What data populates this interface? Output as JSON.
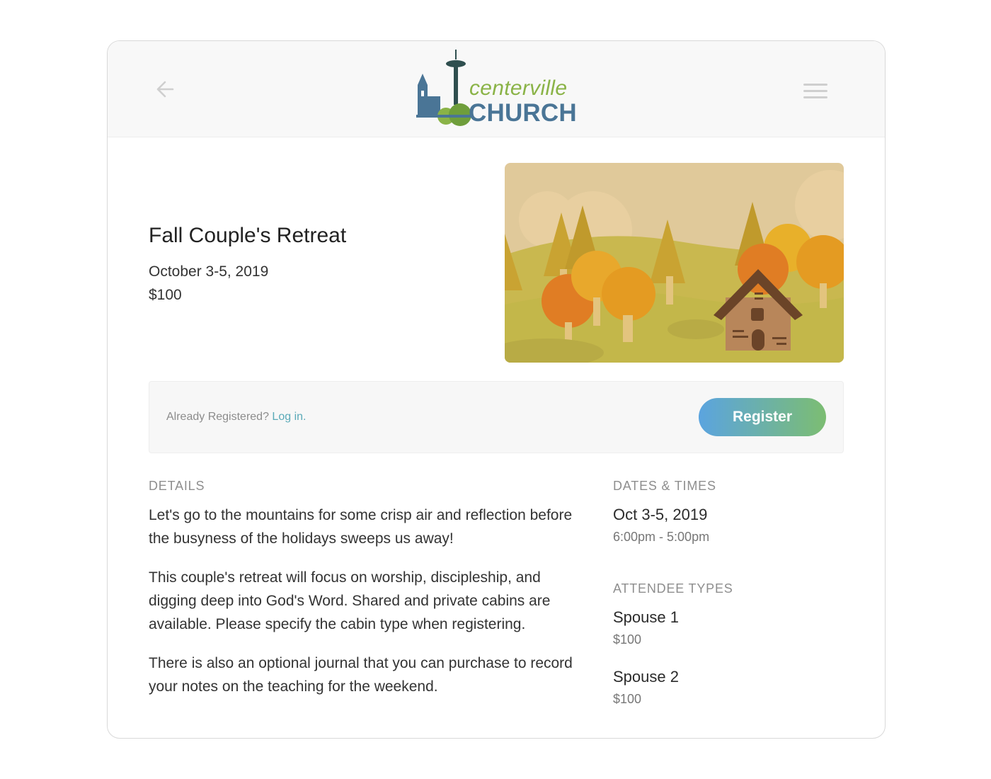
{
  "header": {
    "back_icon": "arrow-left-icon",
    "menu_icon": "hamburger-menu-icon",
    "logo": {
      "word1": "centerville",
      "word2": "CHURCH"
    }
  },
  "event": {
    "title": "Fall Couple's Retreat",
    "date": "October 3-5, 2019",
    "price": "$100"
  },
  "registration": {
    "prompt": "Already Registered?",
    "login_label": "Log in.",
    "register_label": "Register"
  },
  "details": {
    "label": "DETAILS",
    "paragraphs": [
      "Let's go to the mountains for some crisp air and reflection before the busyness of the holidays sweeps us away!",
      "This couple's retreat will focus on worship, discipleship, and digging deep into God's Word. Shared and private cabins are available. Please specify the cabin type when registering.",
      "There is also an optional journal that you can purchase to record your notes on the teaching for the weekend."
    ]
  },
  "dates_times": {
    "label": "DATES & TIMES",
    "date": "Oct 3-5, 2019",
    "time": "6:00pm - 5:00pm"
  },
  "attendee_types": {
    "label": "ATTENDEE TYPES",
    "items": [
      {
        "name": "Spouse 1",
        "price": "$100"
      },
      {
        "name": "Spouse 2",
        "price": "$100"
      }
    ]
  },
  "colors": {
    "accent_link": "#5aaab8",
    "register_gradient_start": "#5ba4df",
    "register_gradient_end": "#7cbd72",
    "logo_green": "#8ab347",
    "logo_blue": "#4a7596"
  }
}
